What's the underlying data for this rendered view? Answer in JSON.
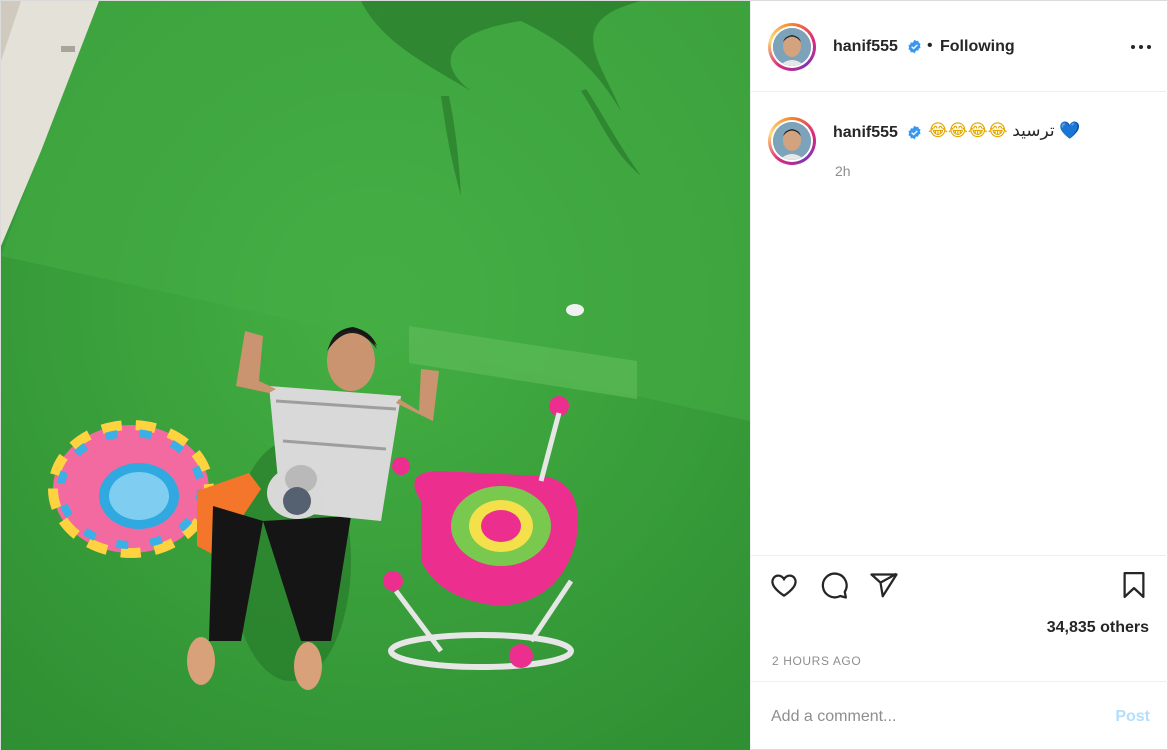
{
  "post": {
    "username": "hanif555",
    "separator": "•",
    "follow_status": "Following",
    "caption": {
      "username": "hanif555",
      "text": "ترسید",
      "emojis": "😂😂😂😂",
      "heart": "💙",
      "time": "2h"
    },
    "likes_text": "34,835 others",
    "posted_ago": "2 HOURS AGO",
    "comment": {
      "placeholder": "Add a comment...",
      "post_label": "Post"
    }
  },
  "icons": {
    "verified": "verified-badge-icon",
    "more": "more-options-icon",
    "like": "heart-icon",
    "comment": "comment-icon",
    "share": "share-icon",
    "save": "bookmark-icon"
  },
  "colors": {
    "accent": "#3897f0",
    "post_button_disabled": "#b2dffc",
    "muted": "#8e8e8e",
    "grass": "#3fa53c"
  }
}
